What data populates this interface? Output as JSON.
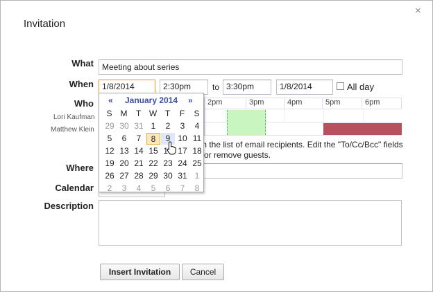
{
  "dialog": {
    "title": "Invitation",
    "close_glyph": "×"
  },
  "labels": {
    "what": "What",
    "when": "When",
    "who": "Who",
    "where": "Where",
    "calendar": "Calendar",
    "description": "Description"
  },
  "what": {
    "value": "Meeting about series"
  },
  "when": {
    "start_date": "1/8/2014",
    "start_time": "2:30pm",
    "to": "to",
    "end_time": "3:30pm",
    "end_date": "1/8/2014",
    "all_day": "All day"
  },
  "who": {
    "people": [
      "Lori Kaufman",
      "Matthew Klein"
    ],
    "hours": [
      "2pm",
      "3pm",
      "4pm",
      "5pm",
      "6pm"
    ],
    "info_line1": "m the list of email recipients. Edit the \"To/Cc/Bcc\" fields",
    "info_line2": "or remove guests."
  },
  "calendar": {
    "prev": "«",
    "next": "»",
    "month_label": "January 2014",
    "dow": [
      "S",
      "M",
      "T",
      "W",
      "T",
      "F",
      "S"
    ],
    "weeks": [
      [
        "29",
        "30",
        "31",
        "1",
        "2",
        "3",
        "4"
      ],
      [
        "5",
        "6",
        "7",
        "8",
        "9",
        "10",
        "11"
      ],
      [
        "12",
        "13",
        "14",
        "15",
        "16",
        "17",
        "18"
      ],
      [
        "19",
        "20",
        "21",
        "22",
        "23",
        "24",
        "25"
      ],
      [
        "26",
        "27",
        "28",
        "29",
        "30",
        "31",
        "1"
      ],
      [
        "2",
        "3",
        "4",
        "5",
        "6",
        "7",
        "8"
      ]
    ],
    "selected_day": "8",
    "hover_day": "9"
  },
  "buttons": {
    "insert": "Insert Invitation",
    "cancel": "Cancel"
  },
  "colors": {
    "busy": "#b7515e",
    "slot": "#c8f5c0",
    "accent": "#3a4fa8"
  }
}
